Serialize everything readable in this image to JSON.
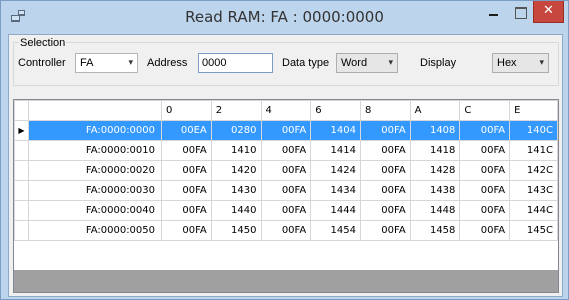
{
  "window": {
    "title": "Read RAM: FA : 0000:0000",
    "close_glyph": "✕"
  },
  "selection": {
    "group_label": "Selection",
    "controller_label": "Controller",
    "controller_value": "FA",
    "address_label": "Address",
    "address_value": "0000",
    "datatype_label": "Data type",
    "datatype_value": "Word",
    "display_label": "Display",
    "display_value": "Hex"
  },
  "grid": {
    "columns": [
      "0",
      "2",
      "4",
      "6",
      "8",
      "A",
      "C",
      "E"
    ],
    "rows": [
      {
        "address": "FA:0000:0000",
        "values": [
          "00EA",
          "0280",
          "00FA",
          "1404",
          "00FA",
          "1408",
          "00FA",
          "140C"
        ]
      },
      {
        "address": "FA:0000:0010",
        "values": [
          "00FA",
          "1410",
          "00FA",
          "1414",
          "00FA",
          "1418",
          "00FA",
          "141C"
        ]
      },
      {
        "address": "FA:0000:0020",
        "values": [
          "00FA",
          "1420",
          "00FA",
          "1424",
          "00FA",
          "1428",
          "00FA",
          "142C"
        ]
      },
      {
        "address": "FA:0000:0030",
        "values": [
          "00FA",
          "1430",
          "00FA",
          "1434",
          "00FA",
          "1438",
          "00FA",
          "143C"
        ]
      },
      {
        "address": "FA:0000:0040",
        "values": [
          "00FA",
          "1440",
          "00FA",
          "1444",
          "00FA",
          "1448",
          "00FA",
          "144C"
        ]
      },
      {
        "address": "FA:0000:0050",
        "values": [
          "00FA",
          "1450",
          "00FA",
          "1454",
          "00FA",
          "1458",
          "00FA",
          "145C"
        ]
      }
    ],
    "selected_row": 0
  },
  "colors": {
    "selection": "#3399ff",
    "title_bar": "#bcd4ec",
    "close_button": "#c7463d"
  }
}
